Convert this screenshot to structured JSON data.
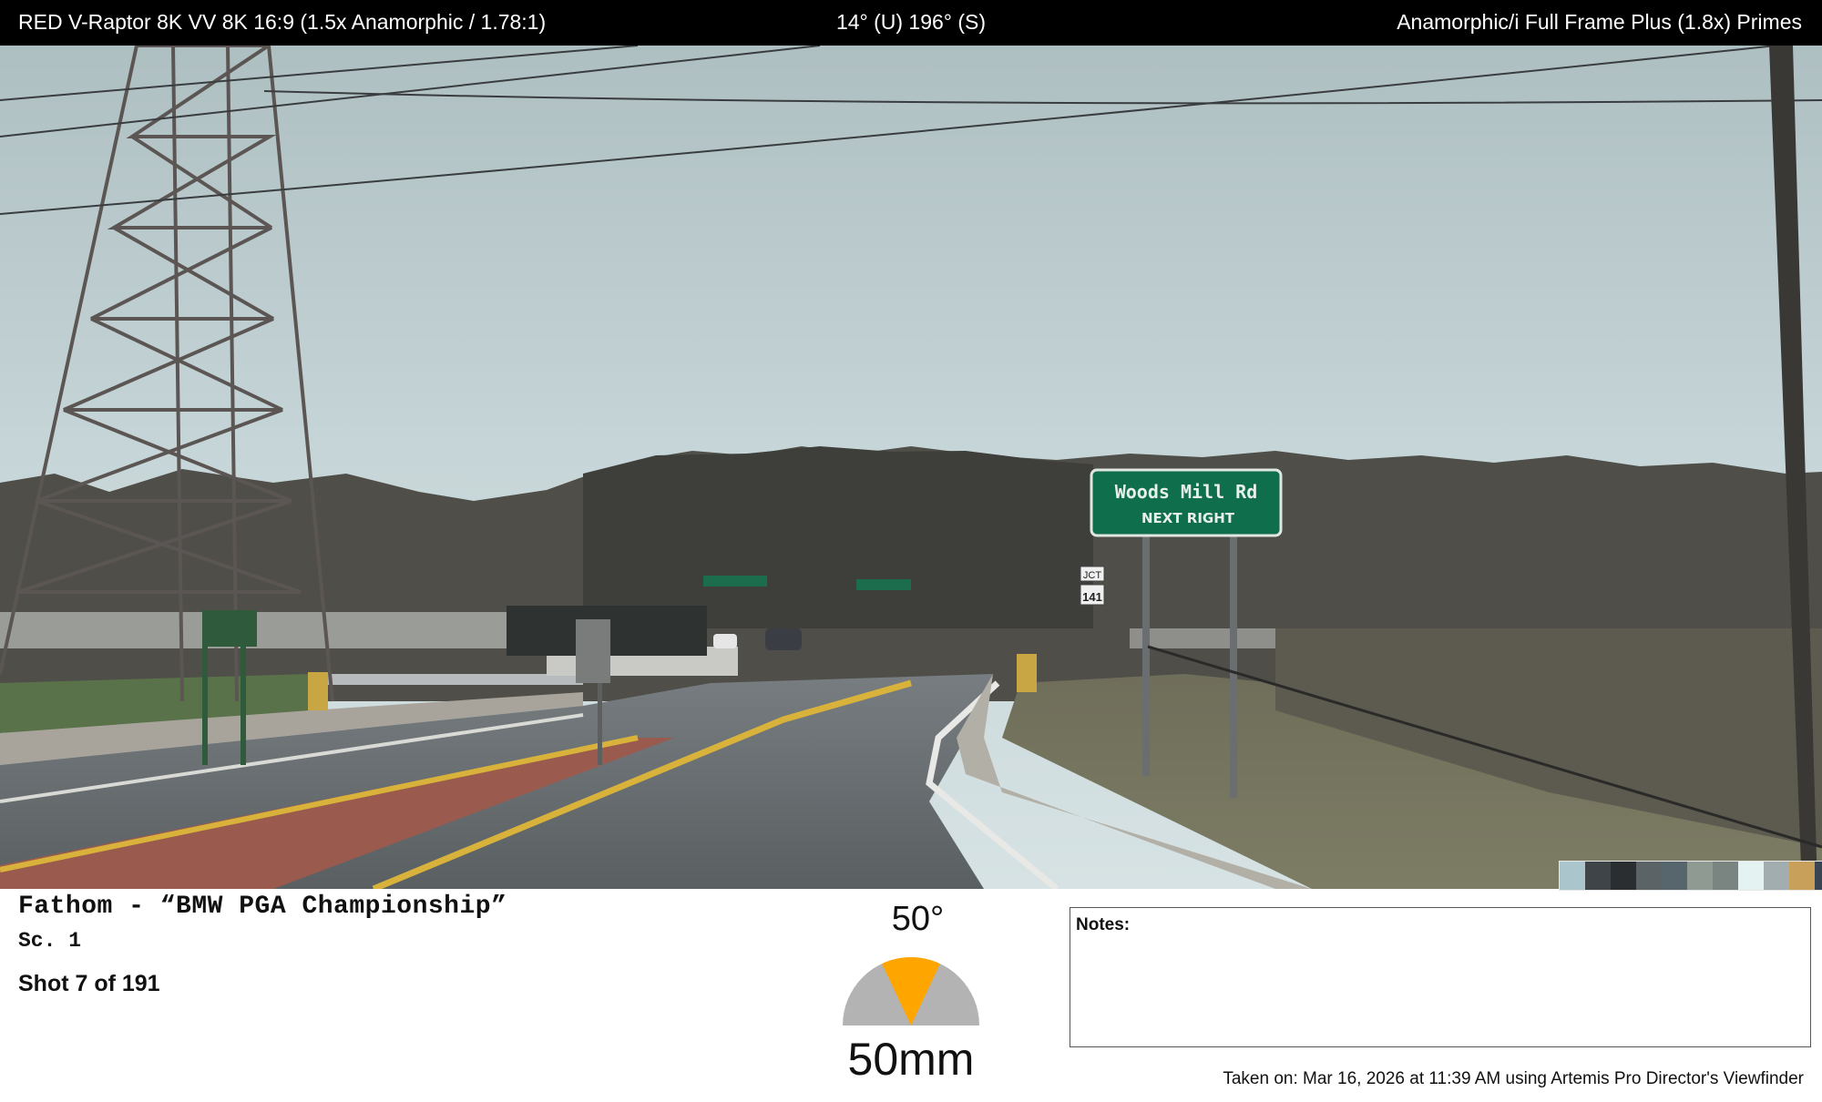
{
  "header": {
    "camera": "RED V-Raptor 8K VV 8K 16:9 (1.5x Anamorphic / 1.78:1)",
    "orientation": "14° (U) 196° (S)",
    "lens": "Anamorphic/i Full Frame Plus (1.8x) Primes"
  },
  "photo": {
    "sign_line1": "Woods Mill Rd",
    "sign_line2": "NEXT RIGHT",
    "route_sign_top": "JCT",
    "route_sign_number": "141"
  },
  "palette": [
    "#aac6cc",
    "#3e4448",
    "#2a2e31",
    "#5b6366",
    "#57666c",
    "#8e9a92",
    "#7a8581",
    "#e4f3f2",
    "#a2adb0",
    "#c9a05a",
    "#3a4553"
  ],
  "project": {
    "title": "Fathom - “BMW PGA Championship”",
    "scene": "Sc. 1",
    "shot": "Shot 7 of 191"
  },
  "lens_info": {
    "fov": "50°",
    "focal_length": "50mm",
    "fov_fraction": 0.28,
    "gauge_color": "#ffa500",
    "gauge_bg": "#b3b3b3"
  },
  "notes": {
    "label": "Notes:"
  },
  "footer": {
    "taken": "Taken on: Mar 16, 2026 at 11:39 AM using Artemis Pro Director's Viewfinder"
  }
}
